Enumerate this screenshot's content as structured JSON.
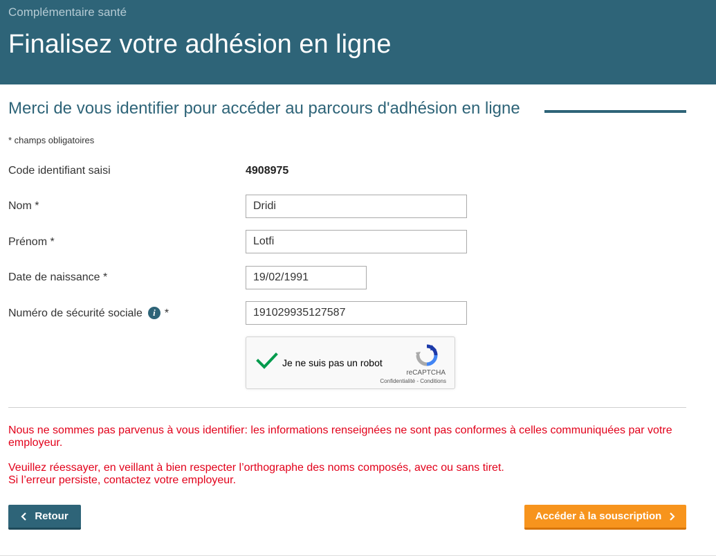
{
  "header": {
    "kicker": "Complémentaire santé",
    "title": "Finalisez votre adhésion en ligne"
  },
  "section": {
    "title": "Merci de vous identifier pour accéder au parcours d'adhésion en ligne",
    "required_note": "* champs obligatoires"
  },
  "form": {
    "code_label": "Code identifiant saisi",
    "code_value": "4908975",
    "nom_label": "Nom *",
    "nom_value": "Dridi",
    "prenom_label": "Prénom *",
    "prenom_value": "Lotfi",
    "dob_label": "Date de naissance *",
    "dob_value": "19/02/1991",
    "ssn_label": "Numéro de sécurité sociale",
    "ssn_required": "*",
    "ssn_value": "191029935127587",
    "info_icon_glyph": "i"
  },
  "captcha": {
    "label": "Je ne suis pas un robot",
    "brand": "reCAPTCHA",
    "links": "Confidentialité - Conditions",
    "checked": true
  },
  "errors": {
    "line1": "Nous ne sommes pas parvenus à vous identifier: les informations renseignées ne sont pas conformes à celles communiquées par votre employeur.",
    "line2": "Veuillez réessayer, en veillant à bien respecter l’orthographe des noms composés, avec ou sans tiret.",
    "line3": "Si l’erreur persiste, contactez votre employeur."
  },
  "buttons": {
    "back": "Retour",
    "next": "Accéder à la souscription"
  },
  "colors": {
    "brand": "#2e6478",
    "accent": "#f7941d",
    "error": "#e2001a",
    "captcha_check": "#009b4d"
  }
}
